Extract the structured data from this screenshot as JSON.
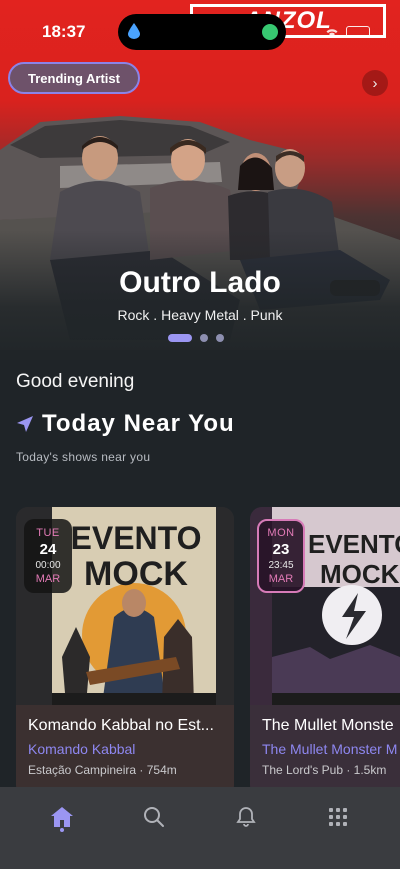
{
  "status_bar": {
    "time": "18:37"
  },
  "hero": {
    "badge": "Trending Artist",
    "poster_text": "ANZOL",
    "artist": "Outro Lado",
    "genres": "Rock . Heavy Metal . Punk",
    "carousel": {
      "count": 3,
      "active": 0
    },
    "next_icon": "chevron-right-icon"
  },
  "greeting": "Good evening",
  "near": {
    "title": "Today Near You",
    "subtitle": "Today's shows near you",
    "icon": "location-arrow-icon"
  },
  "events": [
    {
      "poster_text_1": "EVENTO",
      "poster_text_2": "MOCK",
      "date": {
        "weekday": "TUE",
        "day": "24",
        "time": "00:00",
        "month": "MAR"
      },
      "title": "Komando Kabbal no Est...",
      "artist": "Komando Kabbal",
      "venue": "Estação Campineira · 754m"
    },
    {
      "poster_text_1": "EVENTO",
      "poster_text_2": "MOCK",
      "date": {
        "weekday": "MON",
        "day": "23",
        "time": "23:45",
        "month": "MAR"
      },
      "title": "The Mullet Monste",
      "artist": "The Mullet Monster M",
      "venue": "The Lord's Pub · 1.5km"
    }
  ],
  "tabbar": {
    "items": [
      "home-icon",
      "search-icon",
      "bell-icon",
      "grid-icon"
    ],
    "active": 0
  },
  "colors": {
    "accent": "#9b96f2",
    "hero_red": "#e2231f",
    "date_pink": "#e27ab6"
  }
}
